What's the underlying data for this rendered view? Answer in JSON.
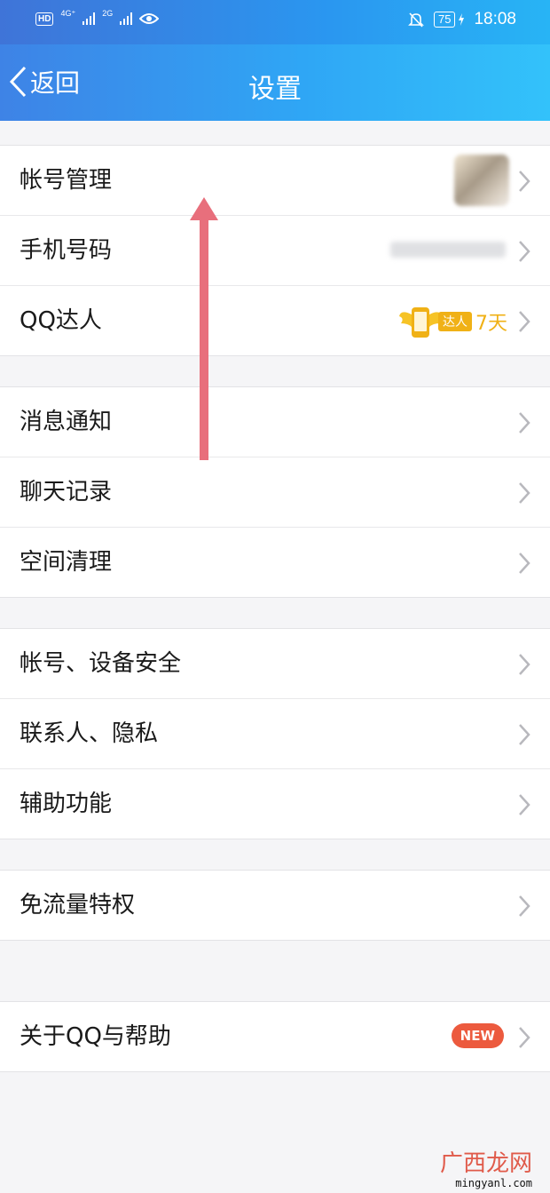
{
  "status_bar": {
    "hd": "HD",
    "net1": "4G⁺",
    "net2": "2G",
    "battery": "75",
    "time": "18:08"
  },
  "header": {
    "back_label": "返回",
    "title": "设置"
  },
  "groups": [
    {
      "items": [
        {
          "label": "帐号管理"
        },
        {
          "label": "手机号码"
        },
        {
          "label": "QQ达人",
          "badge_text": "达人",
          "badge_days": "7天"
        }
      ]
    },
    {
      "items": [
        {
          "label": "消息通知"
        },
        {
          "label": "聊天记录"
        },
        {
          "label": "空间清理"
        }
      ]
    },
    {
      "items": [
        {
          "label": "帐号、设备安全"
        },
        {
          "label": "联系人、隐私"
        },
        {
          "label": "辅助功能"
        }
      ]
    },
    {
      "items": [
        {
          "label": "免流量特权"
        }
      ]
    },
    {
      "items": [
        {
          "label": "关于QQ与帮助",
          "new_badge": "NEW"
        }
      ]
    }
  ],
  "watermark": {
    "text": "广西龙网",
    "sub": "mingyanl.com"
  },
  "colors": {
    "header_start": "#3e83e6",
    "header_end": "#33c2fa",
    "annotation_arrow": "#e86f7c",
    "daren_gold": "#f0b116",
    "new_badge": "#ec5a3e"
  }
}
